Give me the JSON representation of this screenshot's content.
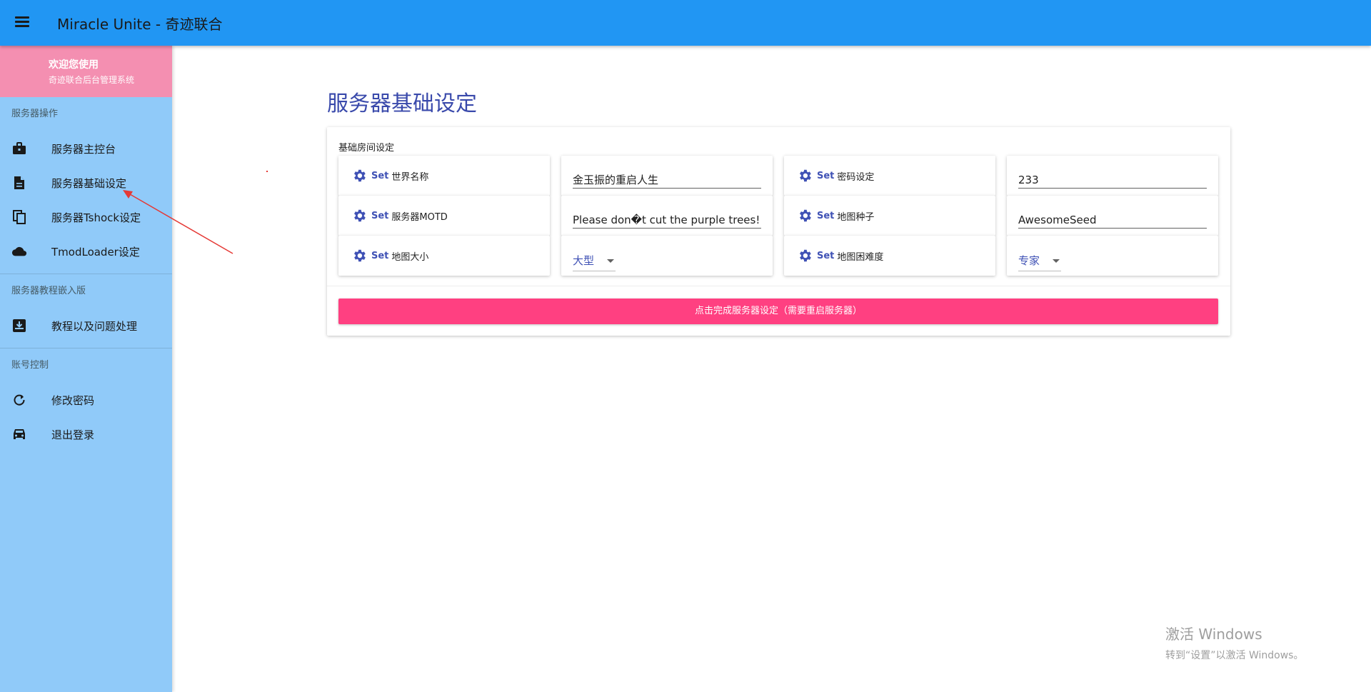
{
  "appbar": {
    "title": "Miracle Unite - 奇迹联合",
    "menu_icon": "menu-icon"
  },
  "sidebar": {
    "welcome_title": "欢迎您使用",
    "welcome_sub": "奇迹联合后台管理系统",
    "sections": [
      {
        "header": "服务器操作",
        "items": [
          {
            "label": "服务器主控台",
            "icon": "briefcase-icon"
          },
          {
            "label": "服务器基础设定",
            "icon": "document-icon"
          },
          {
            "label": "服务器Tshock设定",
            "icon": "copy-icon"
          },
          {
            "label": "TmodLoader设定",
            "icon": "cloud-icon"
          }
        ]
      },
      {
        "header": "服务器教程嵌入版",
        "items": [
          {
            "label": "教程以及问题处理",
            "icon": "inbox-download-icon"
          }
        ]
      },
      {
        "header": "账号控制",
        "items": [
          {
            "label": "修改密码",
            "icon": "refresh-icon"
          },
          {
            "label": "退出登录",
            "icon": "car-icon"
          }
        ]
      }
    ]
  },
  "main": {
    "title": "服务器基础设定",
    "card_subtitle": "基础房间设定",
    "set_word": "Set",
    "settings": [
      {
        "label": "世界名称",
        "value": "金玉振的重启人生",
        "kind": "text"
      },
      {
        "label": "密码设定",
        "value": "233",
        "kind": "text"
      },
      {
        "label": "服务器MOTD",
        "value": "Please don�t cut the purple trees!",
        "kind": "text"
      },
      {
        "label": "地图种子",
        "value": "AwesomeSeed",
        "kind": "text"
      },
      {
        "label": "地图大小",
        "value": "大型",
        "kind": "select"
      },
      {
        "label": "地图困难度",
        "value": "专家",
        "kind": "select"
      }
    ],
    "submit_label": "点击完成服务器设定（需要重启服务器）"
  },
  "watermark": {
    "line1": "激活 Windows",
    "line2": "转到“设置”以激活 Windows。"
  },
  "colors": {
    "appbar": "#2196f3",
    "sidebar": "#90caf9",
    "welcome": "#f48fb1",
    "accent": "#ff4081",
    "primary": "#3f51b5"
  }
}
